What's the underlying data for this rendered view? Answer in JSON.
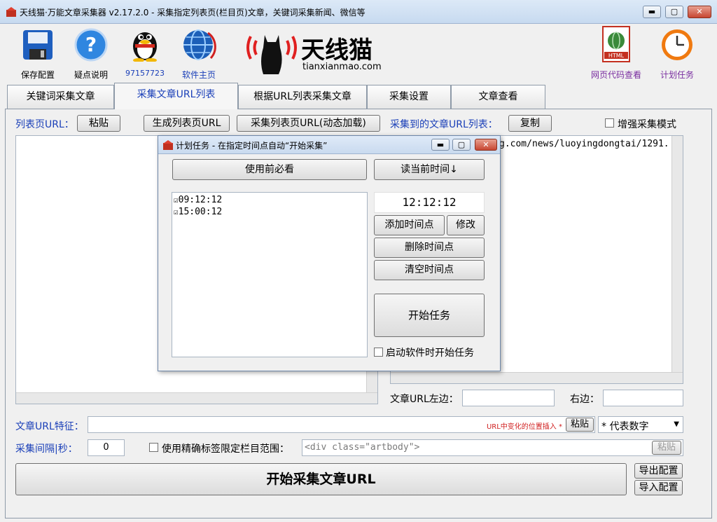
{
  "window": {
    "title": "天线猫·万能文章采集器 v2.17.2.0 - 采集指定列表页(栏目页)文章，关键词采集新闻、微信等",
    "minimize": "▬",
    "maximize": "▢",
    "close": "✕"
  },
  "toolbar": {
    "save_config": "保存配置",
    "help": "疑点说明",
    "qq": "97157723",
    "homepage": "软件主页",
    "html_viewer": "网页代码查看",
    "schedule": "计划任务"
  },
  "logo": {
    "name": "天线猫",
    "domain": "tianxianmao.com"
  },
  "tabs": [
    {
      "label": "关键词采集文章"
    },
    {
      "label": "采集文章URL列表"
    },
    {
      "label": "根据URL列表采集文章"
    },
    {
      "label": "采集设置"
    },
    {
      "label": "文章查看"
    }
  ],
  "main": {
    "list_url_label": "列表页URL：",
    "paste_button": "粘贴",
    "generate_button": "生成列表页URL",
    "collect_dynamic_button": "采集列表页URL(动态加载)",
    "collected_label": "采集到的文章URL列表：",
    "copy_button": "复制",
    "enhance_mode_label": "增强采集模式",
    "url_list_partial": "g.com/news/luoyingdongtai/1291.",
    "left_label": "文章URL左边：",
    "right_label": "右边：",
    "feature_label": "文章URL特征：",
    "insert_hint": "URL中变化的位置插入 *",
    "feature_paste": "粘贴",
    "feature_select": "* 代表数字",
    "interval_label": "采集间隔|秒：",
    "interval_value": "0",
    "precise_label": "使用精确标签限定栏目范围：",
    "precise_placeholder": "<div class=\"artbody\">",
    "precise_paste": "粘贴",
    "start_button": "开始采集文章URL",
    "export_button": "导出配置",
    "import_button": "导入配置"
  },
  "dialog": {
    "title": "计划任务 - 在指定时间点自动“开始采集”",
    "must_read": "使用前必看",
    "read_time": "读当前时间↓",
    "times": [
      "09:12:12",
      "15:00:12"
    ],
    "current_time": "12:12:12",
    "add_time": "添加时间点",
    "modify": "修改",
    "delete_time": "删除时间点",
    "clear_time": "清空时间点",
    "start_task": "开始任务",
    "autostart_label": "启动软件时开始任务"
  }
}
